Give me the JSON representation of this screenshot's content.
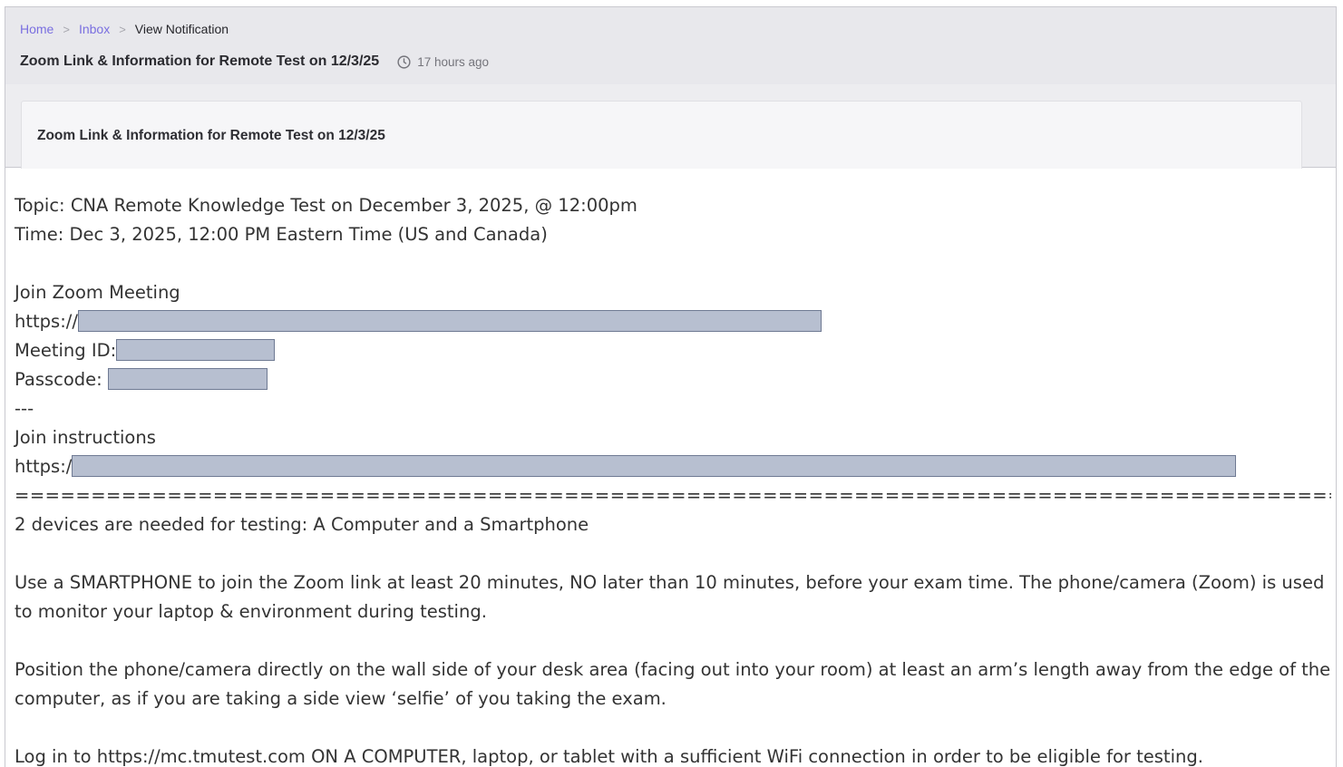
{
  "breadcrumb": {
    "home": "Home",
    "inbox": "Inbox",
    "current": "View Notification",
    "separator": ">"
  },
  "header": {
    "title": "Zoom Link & Information for Remote Test on 12/3/25",
    "time_ago": "17 hours ago",
    "time_icon": "clock-icon"
  },
  "card": {
    "title": "Zoom Link & Information for Remote Test on 12/3/25"
  },
  "message": {
    "topic": "Topic: CNA Remote Knowledge Test on December 3, 2025, @ 12:00pm",
    "time": "Time: Dec 3, 2025, 12:00 PM Eastern Time (US and Canada)",
    "join_zoom": "Join Zoom Meeting",
    "url_prefix": "https://",
    "meeting_id_label": "Meeting ID:",
    "passcode_label": "Passcode: ",
    "divider_dashes": "---",
    "join_instructions": "Join instructions",
    "instructions_url_prefix": "https:/",
    "equals_rule": "==========================================================================================",
    "devices": "2 devices are needed for testing: A Computer and a Smartphone",
    "smartphone_para": "Use a SMARTPHONE to join the Zoom link at least 20 minutes, NO later than 10 minutes, before your exam time. The phone/camera (Zoom) is used to monitor your laptop & environment during testing.",
    "position_para": "Position the phone/camera directly on the wall side of your desk area (facing out into your room) at least an arm’s length away from the edge of the computer, as if you are taking a side view ‘selfie’ of you taking the exam.",
    "login_para": "Log in to https://mc.tmutest.com ON A COMPUTER, laptop, or tablet with a sufficient WiFi connection in order to be eligible for testing."
  },
  "colors": {
    "link": "#7a6fe0",
    "header_bg": "#e8e8ec",
    "redaction": "#b7bfd0"
  }
}
